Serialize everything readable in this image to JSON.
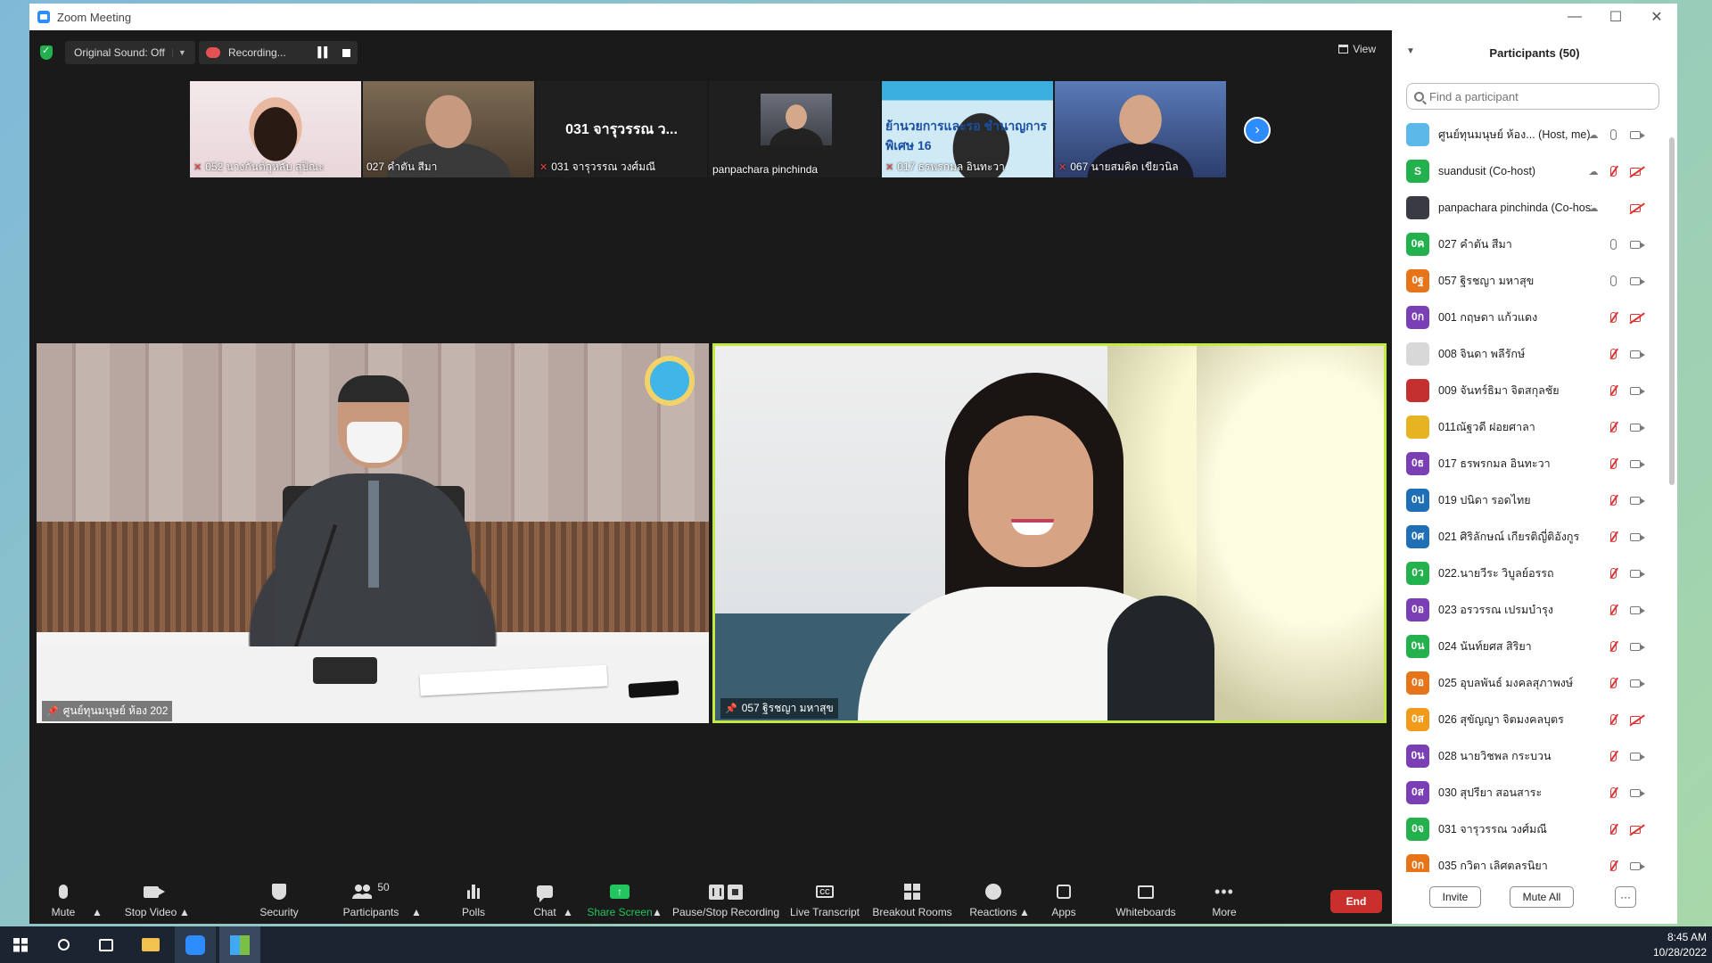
{
  "window": {
    "title": "Zoom Meeting",
    "minimize": "—",
    "maximize": "☐",
    "close": "✕"
  },
  "topbar": {
    "original_sound": "Original Sound: Off",
    "recording": "Recording...",
    "view": "View"
  },
  "strip": [
    {
      "label": "052 นางกันต์กุหลับ สุปิณะ",
      "muted": true
    },
    {
      "label": "027 คำตัน สีมา",
      "muted": false
    },
    {
      "label": "031 จารุวรรณ วงศ์มณี",
      "muted": true,
      "big_text": "031 จารุวรรณ ว..."
    },
    {
      "label": "panpachara pinchinda",
      "muted": false
    },
    {
      "label": "017 ธรพรกมล อินทะวา",
      "muted": true,
      "banner": "ย้านวยการและรอ ชำนาญการพิเศษ 16"
    },
    {
      "label": "067 นายสมคิด เขียวนิล",
      "muted": true
    }
  ],
  "tiles": {
    "left_label": "ศูนย์ทุนมนุษย์ ห้อง 202",
    "right_label": "057 ฐิรชญา มหาสุข"
  },
  "toolbar": {
    "mute": "Mute",
    "stop_video": "Stop Video",
    "security": "Security",
    "participants": "Participants",
    "participants_count": "50",
    "polls": "Polls",
    "chat": "Chat",
    "share_screen": "Share Screen",
    "pause_stop_recording": "Pause/Stop Recording",
    "live_transcript": "Live Transcript",
    "breakout_rooms": "Breakout Rooms",
    "reactions": "Reactions",
    "apps": "Apps",
    "whiteboards": "Whiteboards",
    "more": "More",
    "end": "End",
    "cc_text": "CC",
    "share_arrow": "↑",
    "more_dots": "•••"
  },
  "panel": {
    "title": "Participants (50)",
    "search_placeholder": "Find a participant",
    "invite": "Invite",
    "mute_all": "Mute All",
    "more": "···",
    "participants": [
      {
        "name": "ศูนย์ทุนมนุษย์ ห้อง... (Host, me)",
        "avatar": "",
        "color": "#5bb8e8",
        "cloud": true,
        "mic": "on",
        "video": "on"
      },
      {
        "name": "suandusit (Co-host)",
        "avatar": "S",
        "color": "#22b14c",
        "cloud": true,
        "mic": "off",
        "video": "off"
      },
      {
        "name": "panpachara pinchinda (Co-host)",
        "avatar": "",
        "color": "#3a3a44",
        "cloud": true,
        "mic": "none",
        "video": "off"
      },
      {
        "name": "027 คำตัน สีมา",
        "avatar": "0ค",
        "color": "#22b14c",
        "cloud": false,
        "mic": "on",
        "video": "on"
      },
      {
        "name": "057 ฐิรชญา มหาสุข",
        "avatar": "0ฐ",
        "color": "#e8741a",
        "cloud": false,
        "mic": "on",
        "video": "on"
      },
      {
        "name": "001 กฤษดา แก้วแดง",
        "avatar": "0ก",
        "color": "#7b3fb5",
        "cloud": false,
        "mic": "off",
        "video": "off"
      },
      {
        "name": "008 จินดา พลีรักษ์",
        "avatar": "",
        "color": "#d8d8d8",
        "cloud": false,
        "mic": "off",
        "video": "on"
      },
      {
        "name": "009 จันทร์ธิมา จิตสกุลชัย",
        "avatar": "",
        "color": "#c43030",
        "cloud": false,
        "mic": "off",
        "video": "on"
      },
      {
        "name": "011ณัฐวดี ฝอยศาลา",
        "avatar": "",
        "color": "#e6b422",
        "cloud": false,
        "mic": "off",
        "video": "on"
      },
      {
        "name": "017 ธรพรกมล อินทะวา",
        "avatar": "0ธ",
        "color": "#7b3fb5",
        "cloud": false,
        "mic": "off",
        "video": "on"
      },
      {
        "name": "019 ปนิดา รอดไทย",
        "avatar": "0ป",
        "color": "#1e6fb5",
        "cloud": false,
        "mic": "off",
        "video": "on"
      },
      {
        "name": "021 ศิริลักษณ์ เกียรติญี่ติอังกูร",
        "avatar": "0ศ",
        "color": "#1e6fb5",
        "cloud": false,
        "mic": "off",
        "video": "on"
      },
      {
        "name": "022.นายวีระ วิบูลย์อรรถ",
        "avatar": "0ว",
        "color": "#22b14c",
        "cloud": false,
        "mic": "off",
        "video": "on"
      },
      {
        "name": "023 อรวรรณ เปรมบำรุง",
        "avatar": "0อ",
        "color": "#7b3fb5",
        "cloud": false,
        "mic": "off",
        "video": "on"
      },
      {
        "name": "024 นันท์ยศส สิริยา",
        "avatar": "0น",
        "color": "#22b14c",
        "cloud": false,
        "mic": "off",
        "video": "on"
      },
      {
        "name": "025 อุบลพันธ์ มงคลสุภาพงษ์",
        "avatar": "0อ",
        "color": "#e8741a",
        "cloud": false,
        "mic": "off",
        "video": "on"
      },
      {
        "name": "026 สุขัญญา จิตมงคลบุตร",
        "avatar": "0ส",
        "color": "#f29a1a",
        "cloud": false,
        "mic": "off",
        "video": "off"
      },
      {
        "name": "028 นายวิชพล กระบวน",
        "avatar": "0น",
        "color": "#7b3fb5",
        "cloud": false,
        "mic": "off",
        "video": "on"
      },
      {
        "name": "030 สุปรียา สอนสาระ",
        "avatar": "0ส",
        "color": "#7b3fb5",
        "cloud": false,
        "mic": "off",
        "video": "on"
      },
      {
        "name": "031 จารุวรรณ วงศ์มณี",
        "avatar": "0จ",
        "color": "#22b14c",
        "cloud": false,
        "mic": "off",
        "video": "off"
      },
      {
        "name": "035 กวิตา เลิศตลรนิยา",
        "avatar": "0ก",
        "color": "#e8741a",
        "cloud": false,
        "mic": "off",
        "video": "on"
      }
    ]
  },
  "taskbar": {
    "time": "8:45 AM",
    "date": "10/28/2022"
  }
}
